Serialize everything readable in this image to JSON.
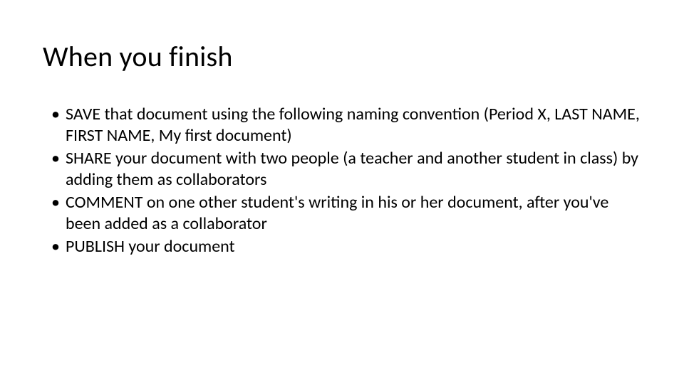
{
  "title": "When you finish",
  "bullets": [
    "SAVE that document using the following naming convention (Period X, LAST NAME, FIRST NAME, My first document)",
    "SHARE your document with two people (a teacher and another student in class) by adding them as collaborators",
    "COMMENT on one other student's writing in his or her document, after you've been added as a collaborator",
    "PUBLISH your document"
  ]
}
